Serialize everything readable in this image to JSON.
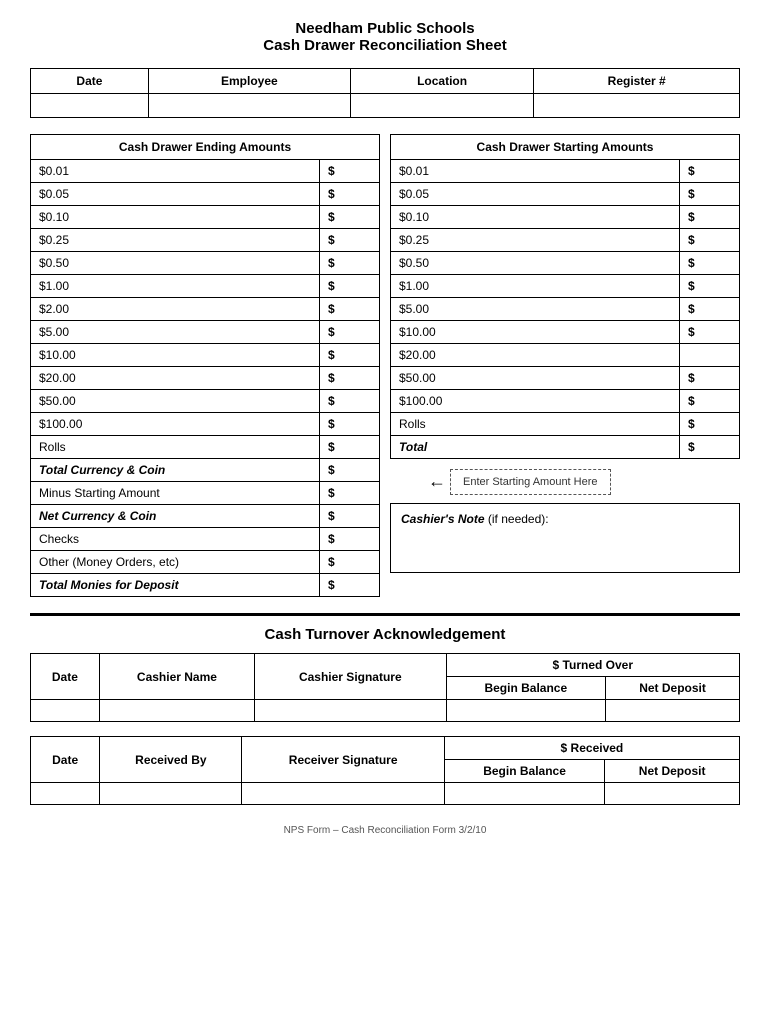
{
  "header": {
    "school": "Needham Public Schools",
    "title": "Cash Drawer Reconciliation Sheet"
  },
  "info_row": {
    "headers": [
      "Date",
      "Employee",
      "Location",
      "Register #"
    ],
    "values": [
      "",
      "",
      "",
      ""
    ]
  },
  "ending_table": {
    "header": "Cash Drawer Ending Amounts",
    "rows": [
      {
        "label": "$0.01",
        "dollar": "$"
      },
      {
        "label": "$0.05",
        "dollar": "$"
      },
      {
        "label": "$0.10",
        "dollar": "$"
      },
      {
        "label": "$0.25",
        "dollar": "$"
      },
      {
        "label": "$0.50",
        "dollar": "$"
      },
      {
        "label": "$1.00",
        "dollar": "$"
      },
      {
        "label": "$2.00",
        "dollar": "$"
      },
      {
        "label": "$5.00",
        "dollar": "$"
      },
      {
        "label": "$10.00",
        "dollar": "$"
      },
      {
        "label": "$20.00",
        "dollar": "$"
      },
      {
        "label": "$50.00",
        "dollar": "$"
      },
      {
        "label": "$100.00",
        "dollar": "$"
      },
      {
        "label": "Rolls",
        "dollar": "$"
      },
      {
        "label": "Total Currency & Coin",
        "dollar": "$",
        "bold": true
      },
      {
        "label": "Minus Starting Amount",
        "dollar": "$"
      },
      {
        "label": "Net Currency & Coin",
        "dollar": "$",
        "bold": true
      },
      {
        "label": "Checks",
        "dollar": "$"
      },
      {
        "label": "Other (Money Orders, etc)",
        "dollar": "$"
      },
      {
        "label": "Total Monies for Deposit",
        "dollar": "$",
        "bold": true
      }
    ]
  },
  "starting_table": {
    "header": "Cash Drawer Starting Amounts",
    "rows": [
      {
        "label": "$0.01",
        "dollar": "$"
      },
      {
        "label": "$0.05",
        "dollar": "$"
      },
      {
        "label": "$0.10",
        "dollar": "$"
      },
      {
        "label": "$0.25",
        "dollar": "$"
      },
      {
        "label": "$0.50",
        "dollar": "$"
      },
      {
        "label": "$1.00",
        "dollar": "$"
      },
      {
        "label": "$5.00",
        "dollar": "$"
      },
      {
        "label": "$10.00",
        "dollar": "$"
      },
      {
        "label": "$20.00",
        "dollar": null
      },
      {
        "label": "$50.00",
        "dollar": "$"
      },
      {
        "label": "$100.00",
        "dollar": "$"
      },
      {
        "label": "Rolls",
        "dollar": "$"
      },
      {
        "label": "Total",
        "dollar": "$",
        "bold": true
      }
    ]
  },
  "starting_amount_note": "Enter Starting Amount Here",
  "cashier_note_label": "Cashier's Note",
  "cashier_note_suffix": " (if needed):",
  "acknowledgement": {
    "header": "Cash Turnover Acknowledgement"
  },
  "turnover_table": {
    "col1": "Date",
    "col2": "Cashier Name",
    "col3": "Cashier Signature",
    "col4_header": "$ Turned Over",
    "col4a": "Begin Balance",
    "col4b": "Net Deposit"
  },
  "received_table": {
    "col1": "Date",
    "col2": "Received By",
    "col3": "Receiver Signature",
    "col4_header": "$ Received",
    "col4a": "Begin Balance",
    "col4b": "Net Deposit"
  },
  "footer": "NPS Form – Cash Reconciliation Form 3/2/10"
}
